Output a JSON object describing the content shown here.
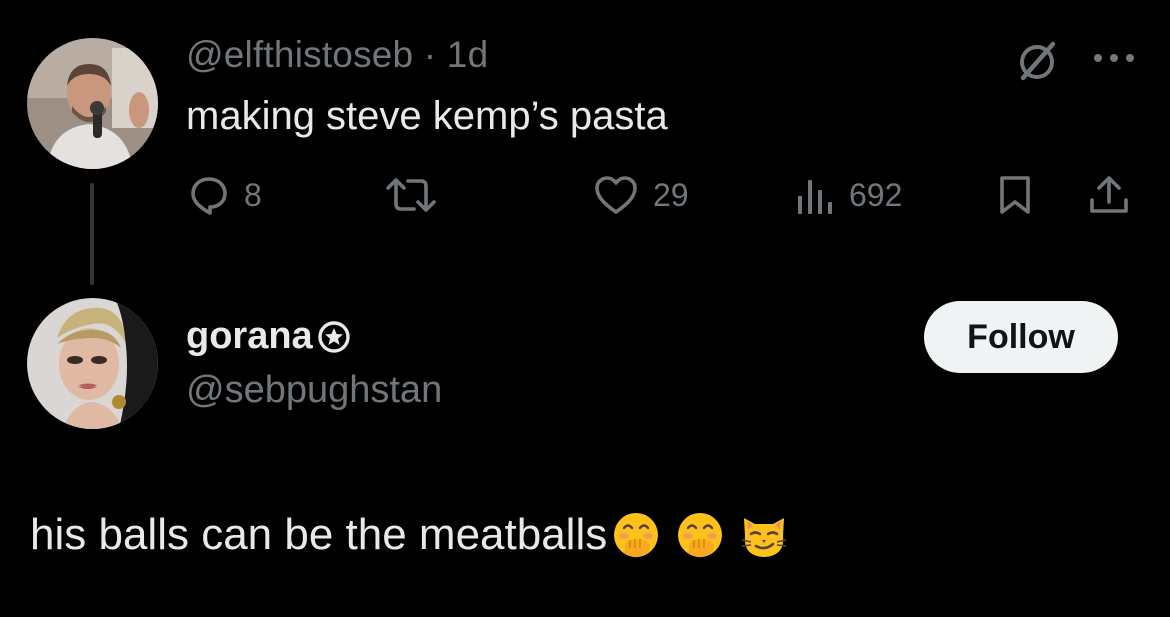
{
  "original_tweet": {
    "meta": "@elfthistoseb · 1d",
    "text": "making steve kemp’s pasta",
    "actions": {
      "reply_count": "8",
      "like_count": "29",
      "view_count": "692"
    }
  },
  "reply_author": {
    "display_name": "gorana",
    "handle": "@sebpughstan",
    "follow_label": "Follow"
  },
  "reply": {
    "text": "his balls can be the meatballs",
    "emojis": [
      "face-with-hand-over-mouth-emoji",
      "face-with-hand-over-mouth-emoji",
      "smirking-cat-emoji"
    ]
  },
  "icons": [
    "grok-icon",
    "more-icon",
    "reply-icon",
    "repost-icon",
    "like-icon",
    "views-icon",
    "bookmark-icon",
    "share-icon",
    "star-badge-icon"
  ],
  "colors": {
    "background": "#000000",
    "text_primary": "#e7e9ea",
    "text_secondary": "#71767b",
    "follow_button_bg": "#eff3f4"
  }
}
